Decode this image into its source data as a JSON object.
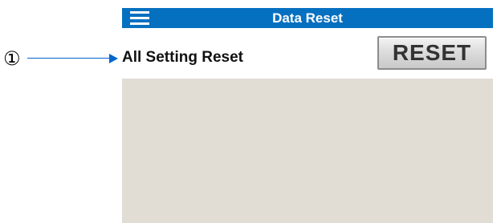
{
  "callout": {
    "number": "①"
  },
  "title_bar": {
    "menu_icon": "hamburger-menu-icon",
    "title": "Data Reset"
  },
  "settings": [
    {
      "label": "All Setting Reset",
      "button_label": "RESET"
    }
  ],
  "colors": {
    "title_bar": "#0670c0",
    "callout_arrow": "#0066cc",
    "content_panel": "#e1ddd4",
    "button_face": "#dcdcdc"
  }
}
